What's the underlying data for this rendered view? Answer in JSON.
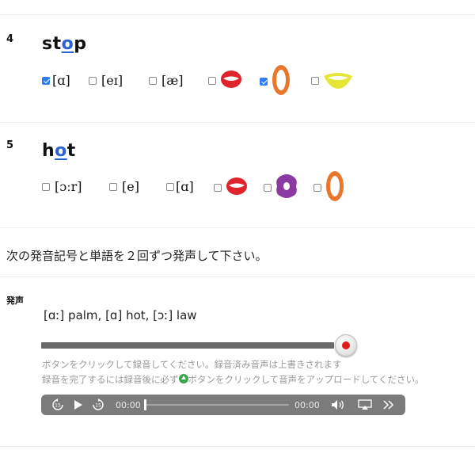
{
  "questions": [
    {
      "number": "4",
      "word_pre": "st",
      "word_hl": "o",
      "word_post": "p",
      "options": [
        {
          "label": "[ɑ]",
          "checked": true
        },
        {
          "label": "[eɪ]",
          "checked": false
        },
        {
          "label": "[æ]",
          "checked": false
        }
      ],
      "mouths": [
        {
          "icon": "red-lips-mouth-icon",
          "color": "#e0242b",
          "checked": false
        },
        {
          "icon": "orange-open-mouth-icon",
          "color": "#e8762c",
          "checked": true
        },
        {
          "icon": "yellow-smile-mouth-icon",
          "color": "#e6e637",
          "checked": false
        }
      ]
    },
    {
      "number": "5",
      "word_pre": "h",
      "word_hl": "o",
      "word_post": "t",
      "options": [
        {
          "label": "[ɔːr]",
          "checked": false
        },
        {
          "label": "[e]",
          "checked": false
        },
        {
          "label": "[ɑ]",
          "checked": false
        }
      ],
      "mouths": [
        {
          "icon": "red-lips-mouth-icon",
          "color": "#e0242b",
          "checked": false
        },
        {
          "icon": "purple-round-mouth-icon",
          "color": "#8a3aa0",
          "checked": false
        },
        {
          "icon": "orange-open-mouth-icon",
          "color": "#e8762c",
          "checked": false
        }
      ]
    }
  ],
  "instruction": "次の発音記号と単語を２回ずつ発声して下さい。",
  "section_label": "発声",
  "phrase": "[ɑː] palm,  [ɑ] hot,  [ɔː] law",
  "notes": {
    "line1": "ボタンをクリックして録音してください。録音済み音声は上書きされます",
    "line2a": "録音を完了するには録音後に必ず",
    "line2b": "ボタンをクリックして音声をアップロードしてください。"
  },
  "player": {
    "current_time": "00:00",
    "duration": "00:00"
  }
}
